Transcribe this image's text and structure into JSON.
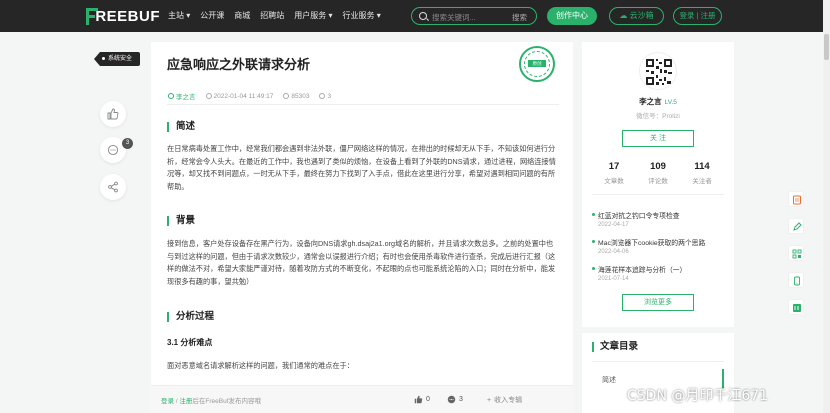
{
  "header": {
    "logo_text": "REEBUF",
    "nav": [
      "主站 ▾",
      "公开课",
      "商城",
      "招聘站",
      "用户服务 ▾",
      "行业服务 ▾"
    ],
    "search_placeholder": "搜索关键词...",
    "search_button": "搜索",
    "create_button": "创作中心",
    "cloud_button": "云沙箱",
    "login_button": "登录 | 注册",
    "accent_color": "#2ab26d"
  },
  "left": {
    "category_tag": "系统安全",
    "comment_badge": "3"
  },
  "article": {
    "title": "应急响应之外联请求分析",
    "stamp_text": "原创",
    "meta": {
      "author": "李之言",
      "date": "2022-01-04 11:49:17",
      "views": "85303",
      "comments": "3"
    },
    "section1_title": "简述",
    "section1_text": "在日常病毒处置工作中，经常我们都会遇到非法外联，僵尸网络这样的情况，在排出的时候却无从下手，不知该如何进行分析，经常会令人头大。在最近的工作中，我也遇到了类似的烦恼，在设备上看到了外联的DNS请求，通过进程，网络连接情况等，却又找不到问题点，一时无从下手，最终在努力下找到了入手点，借此在这里进行分享，希望对遇到相同问题的有所帮助。",
    "section2_title": "背景",
    "section2_text": "接到信息，客户处存设备存在黑产行为，设备向DNS请求gh.dsaj2a1.org域名的解析，并且请求次数总多。之前的处置中也与到过这样的问题，但由于请求次数较少，通常会以误报进行介绍；有时也会使用杀毒软件进行查杀，完成后进行汇报（这样的做法不对，希望大家能严谨对待，随着攻防方式的不断变化，不起眼的点也可能系统沦陷的入口；同时在分析中，能发现很多有趣的事，望共勉）",
    "section3_title": "分析过程",
    "subsection_title": "3.1 分析难点",
    "subsection_text": "面对恶意域名请求解析这样的问题，我们通常的难点在于："
  },
  "profile": {
    "name": "李之言",
    "level": "LV.5",
    "intro": "微信号：Prolizi",
    "follow_button": "关 注",
    "stats": [
      {
        "num": "17",
        "label": "文章数"
      },
      {
        "num": "109",
        "label": "评论数"
      },
      {
        "num": "114",
        "label": "关注者"
      }
    ],
    "related": [
      {
        "title": "红蓝对抗之钓口令专项检查",
        "date": "2022-04-17"
      },
      {
        "title": "Mac浏览器下cookie获取的两个思路",
        "date": "2022-04-06"
      },
      {
        "title": "海莲花样本追踪与分析（一）",
        "date": "2021-07-14"
      }
    ],
    "more_button": "浏览更多"
  },
  "toc": {
    "title": "文章目录",
    "items": [
      "简述"
    ]
  },
  "bottom": {
    "login_link": "登录",
    "register_link": "注册",
    "hint_text": "后在FreeBuf发布内容哦",
    "likes": "0",
    "comments": "3",
    "collect": "收入专辑"
  },
  "watermark": "CSDN @月印千江671"
}
